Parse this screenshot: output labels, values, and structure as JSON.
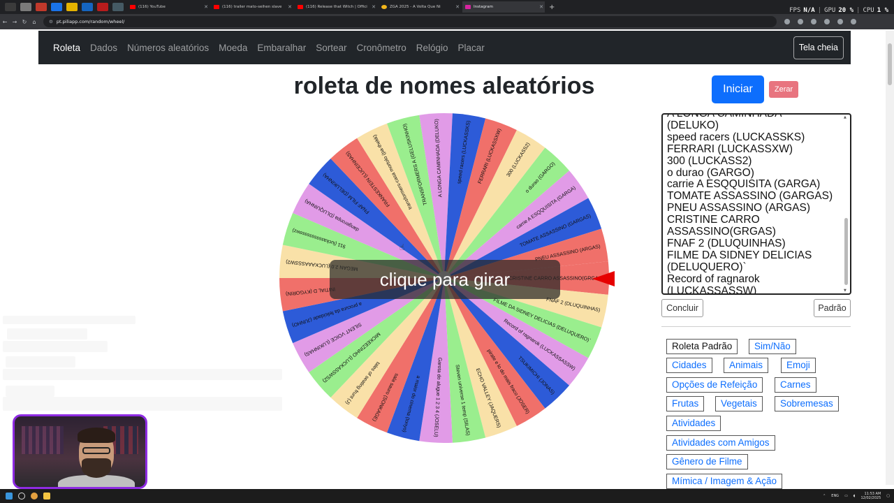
{
  "browser": {
    "tabs": [
      {
        "title": "(116) YouTube",
        "favicon": "youtube-icon"
      },
      {
        "title": "(116) trailer mato-seihen slave",
        "favicon": "youtube-icon"
      },
      {
        "title": "(116) Release that Witch | Offici",
        "favicon": "youtube-icon"
      },
      {
        "title": "ZGA 2025 - A Volta Que Ni",
        "favicon": "zga-icon"
      },
      {
        "title": "Instagram",
        "favicon": "instagram-icon"
      }
    ],
    "url": "pt.piliapp.com/random/wheel/",
    "new_tab": "+"
  },
  "overlay_stats": {
    "fps_label": "FPS",
    "fps_value": "N/A",
    "gpu_label": "GPU",
    "gpu_value": "20 %",
    "cpu_label": "CPU",
    "cpu_value": "1 %"
  },
  "nav": {
    "items": [
      "Roleta",
      "Dados",
      "Números aleatórios",
      "Moeda",
      "Embaralhar",
      "Sortear",
      "Cronômetro",
      "Relógio",
      "Placar"
    ],
    "active_index": 0,
    "fullscreen_label": "Tela cheia"
  },
  "main": {
    "title": "roleta de nomes aleatórios",
    "start_label": "Iniciar",
    "reset_label": "Zerar",
    "spin_prompt": "clique para girar"
  },
  "names_list": [
    "A LONGA CAMINHADA",
    "(DELUKO)",
    "speed racers (LUCKASSKS)",
    "FERRARI (LUCKASSXW)",
    "300 (LUCKASS2)",
    "o durao (GARGO)",
    "carrie A ESQQUISITA (GARGA)",
    "TOMATE ASSASSINO (GARGAS)",
    "PNEU ASSASSINO (ARGAS)",
    "CRISTINE CARRO",
    "ASSASSINO(GRGAS)",
    "FNAF 2 (DLUQUINHAS)",
    "FILME DA SIDNEY DELICIAS",
    "(DELUQUERO)`",
    "Record of ragnarok",
    "(LUCKASSASSW)"
  ],
  "buttons": {
    "done_label": "Concluir",
    "default_label": "Padrão"
  },
  "presets": [
    "Roleta Padrão",
    "Sim/Não",
    "Cidades",
    "Animais",
    "Emoji",
    "Opções de Refeição",
    "Carnes",
    "Frutas",
    "Vegetais",
    "Sobremesas",
    "Atividades",
    "Atividades com Amigos",
    "Gênero de Filme",
    "Mímica / Imagem & Ação"
  ],
  "wheel": {
    "segment_colors": [
      "#f0706a",
      "#f9e1a8",
      "#9aee8e",
      "#e19be7",
      "#2d5bd8"
    ],
    "pointer_color": "#e60000",
    "segments": [
      "CRISTINE CARRO ASSASSINO(GRGAS)",
      "FNAF 2 (DLUQUINHAS)",
      "FILME DA SIDNEY DELICIAS (DELUQUERO)`",
      "Record of ragnarok (LUCKASSASSW)",
      "TSUKIMICHI (JONAS)",
      "pirate e lo do mais fraco (JOSER)",
      "ECHO VALLEY (JAQUERS)",
      "Steven universe 1 temp (SILAS)",
      "Garota do alugue 1 2 3 4 (JOSELU)",
      "a maior do cinema (tonyo)",
      "sala sauro (SONKAGE)",
      "tales of seating frunt (J)",
      "MICKEEZINHO (LUCKASSWSZ)",
      "SILENT VOICE (LUKINHAS)",
      "a procura da felicidade (JUNHO)",
      "INITIAL D (KYGORIN)",
      "MEGAN 2.0 (LUCKAAASSSW2)",
      "911 (luckasssssssssswz)",
      "dangeronpa (DLUQUINHA)",
      "FNAF FILM (DELUKINHA)",
      "FRANKESTEIN (LUCEINHAS)",
      "transformers-casa mortolo (pa-thekk)",
      "TRANSFORMERS A (GELUSKINHO)",
      "A LONGA CAMINHADA (DELUKO)",
      "speed racers (LUCKASSKS)",
      "FERRARI (LUCKASSXW)",
      "300 (LUCKASS2)",
      "o durao (GARGO)",
      "carrie A ESQQUISITA (GARGA)",
      "TOMATE ASSASSINO (GARGAS)",
      "PNEU ASSASSINO (ARGAS)"
    ]
  },
  "taskbar": {
    "lang": "ENG",
    "time": "11:53 AM",
    "date": "12/02/2025"
  }
}
